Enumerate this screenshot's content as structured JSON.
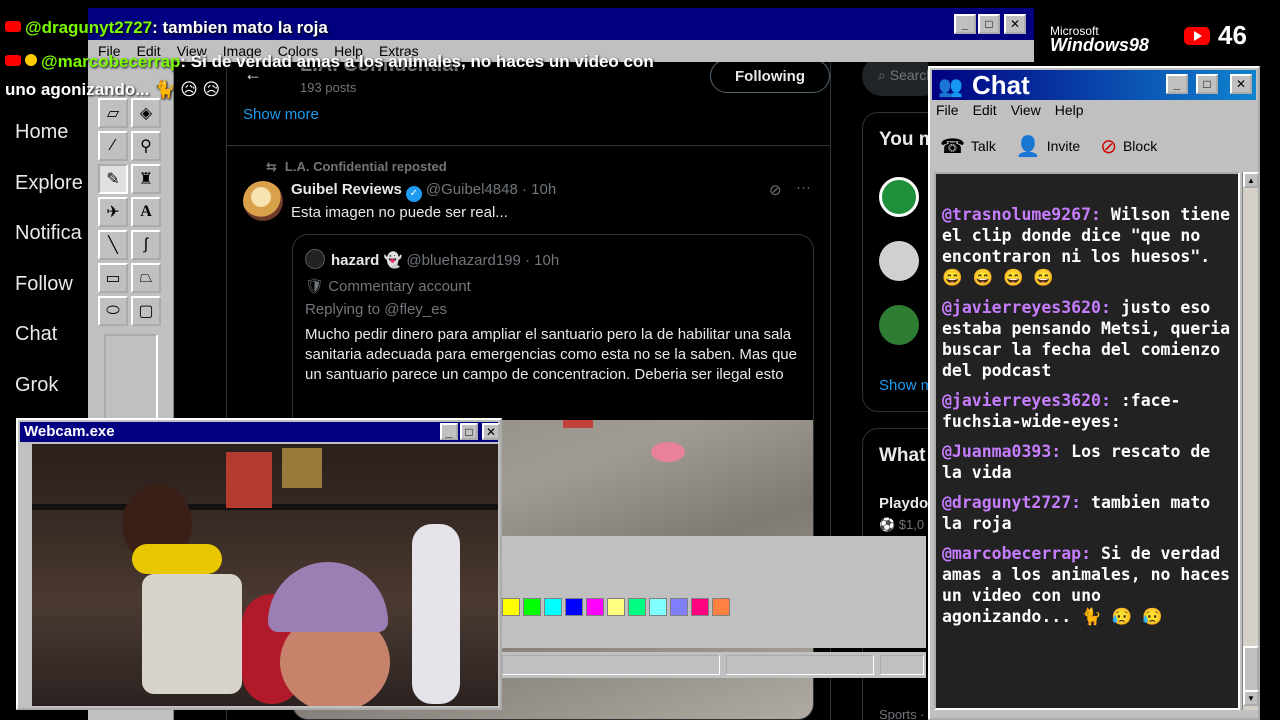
{
  "overlay_chat": {
    "line1": {
      "user": "@dragunyt2727",
      "text": ": tambien mato la roja"
    },
    "line2": {
      "user": "@marcobecerrap",
      "text": ": Si de verdad amas a los animales, no haces un video con"
    },
    "line3": {
      "text": "uno agonizando... 🐈 😥 😥"
    }
  },
  "paint": {
    "menu": [
      "File",
      "Edit",
      "View",
      "Image",
      "Colors",
      "Help",
      "Extras"
    ],
    "palette": [
      "#ffff00",
      "#00ff00",
      "#00ffff",
      "#0000ff",
      "#ff00ff",
      "#ffff80",
      "#00ff80",
      "#80ffff",
      "#8080ff",
      "#ff0080",
      "#ff8040"
    ]
  },
  "x_nav": [
    "Home",
    "Explore",
    "Notifica",
    "Follow",
    "Chat",
    "Grok"
  ],
  "profile": {
    "title": "L.A. Confidential",
    "posts": "193 posts",
    "following": "Following",
    "show_more": "Show more"
  },
  "tweet": {
    "repost_label": "L.A. Confidential reposted",
    "author": "Guibel Reviews",
    "handle": "@Guibel4848 · 10h",
    "text": "Esta imagen no puede ser real...",
    "quote": {
      "author": "hazard 👻",
      "handle": "@bluehazard199 · 10h",
      "label": "Commentary account",
      "reply": "Replying to @fley_es",
      "body": "Mucho pedir dinero para ampliar el santuario pero la de habilitar una sala sanitaria adecuada para emergencias como esta no se la saben. Mas que un santuario parece un campo de concentracion. Deberia ser ilegal esto"
    }
  },
  "x_right": {
    "search": "Search",
    "you_might": "You m",
    "show_more": "Show m",
    "whats": "What",
    "trend": "Playdo",
    "trend_meta": "⚽ $1,0",
    "sports": "Sports ·"
  },
  "brand": {
    "microsoft": "Microsoft",
    "windows": "Windows98",
    "viewers": "46"
  },
  "chat": {
    "title": "Chat",
    "menu": [
      "File",
      "Edit",
      "View",
      "Help"
    ],
    "toolbar": {
      "talk": "Talk",
      "invite": "Invite",
      "block": "Block"
    },
    "messages": [
      {
        "user": "@trasnolume9267:",
        "text": "Wilson tiene el clip donde dice \"que no encontraron ni los huesos\". 😄 😄 😄 😄"
      },
      {
        "user": "@javierreyes3620:",
        "text": "justo eso estaba pensando Metsi, queria buscar la fecha del comienzo del podcast"
      },
      {
        "user": "@javierreyes3620:",
        "text": ":face-fuchsia-wide-eyes:"
      },
      {
        "user": "@Juanma0393:",
        "text": "Los rescato de la vida"
      },
      {
        "user": "@dragunyt2727:",
        "text": "tambien mato la roja"
      },
      {
        "user": "@marcobecerrap:",
        "text": "Si de verdad amas a los animales, no haces un video con uno agonizando... 🐈 😥 😥"
      }
    ]
  },
  "webcam": {
    "title": "Webcam.exe"
  }
}
